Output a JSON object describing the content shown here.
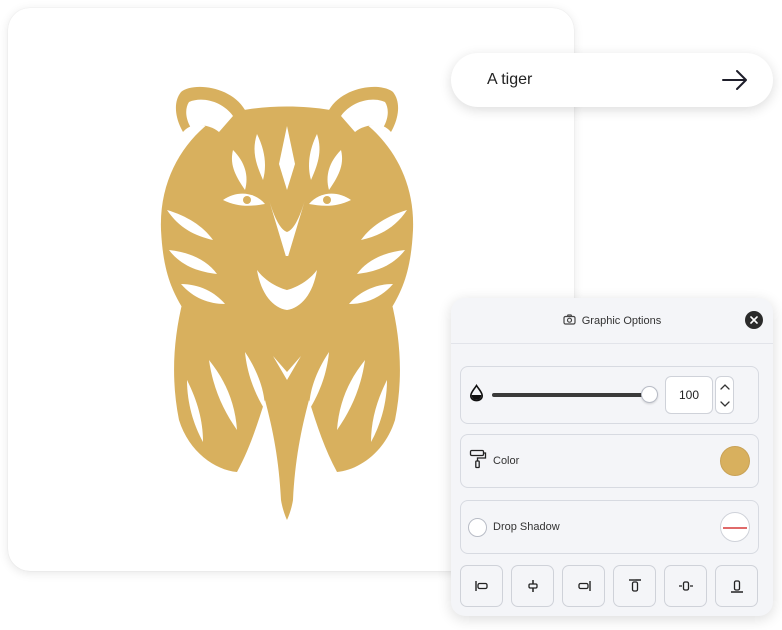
{
  "prompt": {
    "value": "A tiger",
    "submit_icon": "arrow-right-icon"
  },
  "canvas": {
    "artwork_icon": "tiger-illustration",
    "artwork_color": "#d8b05e"
  },
  "panel": {
    "title": "Graphic Options",
    "title_icon": "camera-icon",
    "close_icon": "close-icon",
    "opacity": {
      "icon": "opacity-drop-icon",
      "value": "100",
      "level_percent": 100
    },
    "color": {
      "icon": "paint-roller-icon",
      "label": "Color",
      "swatch": "#d8b05e"
    },
    "drop_shadow": {
      "label": "Drop Shadow",
      "enabled": false,
      "swatch_icon": "no-shadow-icon"
    },
    "align_buttons": [
      "align-left-icon",
      "align-center-horizontal-icon",
      "align-right-icon",
      "align-top-icon",
      "align-middle-vertical-icon",
      "align-bottom-icon"
    ]
  }
}
